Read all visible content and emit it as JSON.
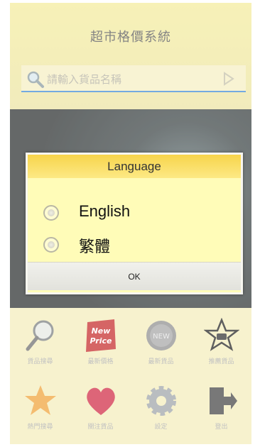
{
  "app": {
    "title": "超市格價系統",
    "search_placeholder": "請輸入貨品名稱"
  },
  "grid": {
    "items": [
      {
        "label": "貨品搜尋",
        "icon": "magnifier-icon"
      },
      {
        "label": "最新價格",
        "icon": "new-price-icon"
      },
      {
        "label": "最新貨品",
        "icon": "new-badge-icon"
      },
      {
        "label": "推薦貨品",
        "icon": "thumbs-up-star-icon"
      },
      {
        "label": "熱門搜尋",
        "icon": "star-icon"
      },
      {
        "label": "關注貨品",
        "icon": "heart-icon"
      },
      {
        "label": "設定",
        "icon": "gear-icon"
      },
      {
        "label": "登出",
        "icon": "logout-icon"
      }
    ],
    "new_price_text_1": "New",
    "new_price_text_2": "Price",
    "new_badge_text": "NEW"
  },
  "dialog": {
    "title": "Language",
    "options": [
      "English",
      "繁體"
    ],
    "ok_label": "OK"
  },
  "colors": {
    "dialog_bg": "#fffcb8",
    "dialog_title_bg": "#f7d44b",
    "app_bg": "#f2ebb6"
  }
}
